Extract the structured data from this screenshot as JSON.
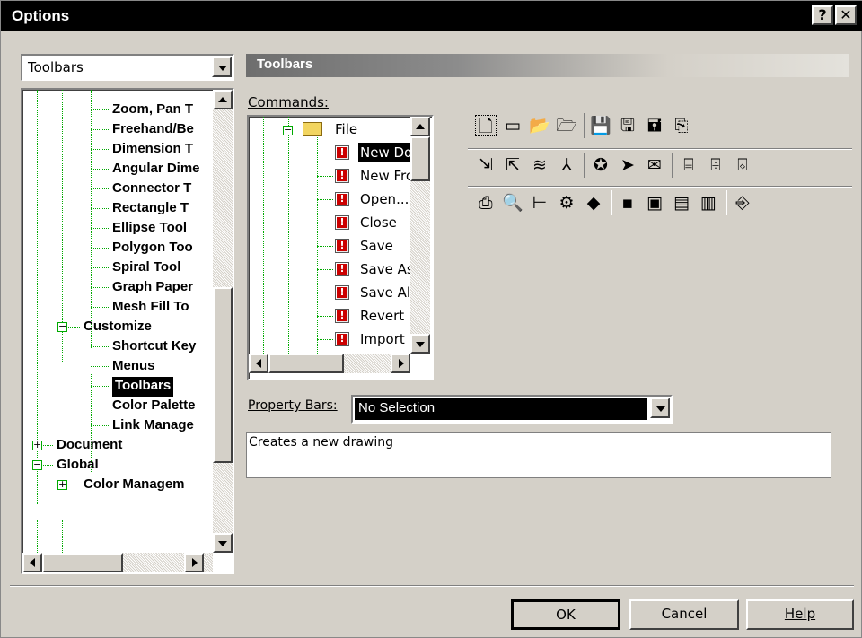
{
  "window": {
    "title": "Options",
    "help_btn": "?",
    "close_btn": "✕"
  },
  "category_dropdown": {
    "value": "Toolbars"
  },
  "tree": {
    "items": [
      {
        "label": "Zoom, Pan T",
        "level": 3
      },
      {
        "label": "Freehand/Be",
        "level": 3
      },
      {
        "label": "Dimension T",
        "level": 3
      },
      {
        "label": "Angular Dime",
        "level": 3
      },
      {
        "label": "Connector T",
        "level": 3
      },
      {
        "label": "Rectangle T",
        "level": 3
      },
      {
        "label": "Ellipse Tool",
        "level": 3
      },
      {
        "label": "Polygon Too",
        "level": 3
      },
      {
        "label": "Spiral Tool",
        "level": 3
      },
      {
        "label": "Graph Paper",
        "level": 3
      },
      {
        "label": "Mesh Fill To",
        "level": 3
      },
      {
        "label": "Customize",
        "level": 2
      },
      {
        "label": "Shortcut Key",
        "level": 3
      },
      {
        "label": "Menus",
        "level": 3
      },
      {
        "label": "Toolbars",
        "level": 3
      },
      {
        "label": "Color Palette",
        "level": 3
      },
      {
        "label": "Link Manage",
        "level": 3
      },
      {
        "label": "Document",
        "level": 1
      },
      {
        "label": "Global",
        "level": 1
      },
      {
        "label": "Color Managem",
        "level": 2
      }
    ]
  },
  "header": {
    "title": "Toolbars"
  },
  "commands": {
    "label": "Commands:",
    "folder": "File",
    "items": [
      "New Docu",
      "New From",
      "Open...",
      "Close",
      "Save",
      "Save As...",
      "Save All",
      "Revert",
      "Import"
    ]
  },
  "property_bars": {
    "label": "Property Bars:",
    "value": "No Selection"
  },
  "description": "Creates a new drawing",
  "buttons": {
    "ok": "OK",
    "cancel": "Cancel",
    "help": "Help"
  },
  "toolbar_icons": {
    "row1": [
      "new-document-icon",
      "new-from-template-icon",
      "open-icon",
      "open-folder-icon",
      "save-icon",
      "save-as-icon",
      "save-all-icon",
      "revert-icon"
    ],
    "row2": [
      "import-icon",
      "export-icon",
      "publish-html-icon",
      "publish-pdf-icon",
      "scan-icon",
      "acquire-icon",
      "send-mail-icon",
      "camera-icon",
      "camera-acquire-icon",
      "camera-select-icon"
    ],
    "row3": [
      "print-icon",
      "print-preview-icon",
      "print-merge-icon",
      "print-setup-icon",
      "color-proof-icon",
      "spread-icon",
      "window-icon",
      "window-tile-icon",
      "window-save-icon",
      "exit-icon"
    ]
  }
}
